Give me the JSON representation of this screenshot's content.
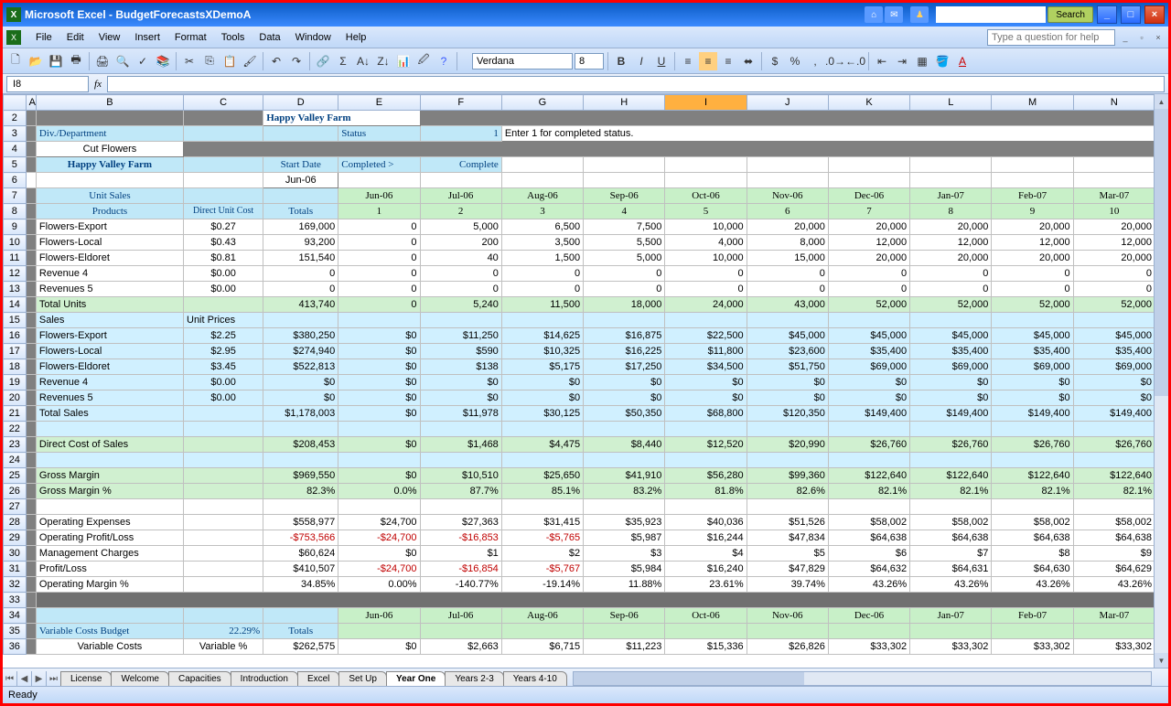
{
  "app": {
    "title": "Microsoft Excel - BudgetForecastsXDemoA",
    "search_btn": "Search"
  },
  "menu": [
    "File",
    "Edit",
    "View",
    "Insert",
    "Format",
    "Tools",
    "Data",
    "Window",
    "Help"
  ],
  "helpbox": "Type a question for help",
  "font": {
    "name": "Verdana",
    "size": "8"
  },
  "namebox": "I8",
  "cols": [
    "A",
    "B",
    "C",
    "D",
    "E",
    "F",
    "G",
    "H",
    "I",
    "J",
    "K",
    "L",
    "M",
    "N"
  ],
  "hdr": {
    "farm": "Happy Valley Farm",
    "div": "Div./Department",
    "status": "Status",
    "status_val": "1",
    "status_note": "Enter 1 for completed status.",
    "cut": "Cut Flowers",
    "start": "Start Date",
    "completed": "Completed >",
    "complete": "Complete",
    "jun06": "Jun-06",
    "unit_sales": "Unit Sales",
    "products": "Products",
    "duc": "Direct Unit Cost",
    "totals": "Totals",
    "months": [
      "Jun-06",
      "Jul-06",
      "Aug-06",
      "Sep-06",
      "Oct-06",
      "Nov-06",
      "Dec-06",
      "Jan-07",
      "Feb-07",
      "Mar-07"
    ],
    "monthnums": [
      "1",
      "2",
      "3",
      "4",
      "5",
      "6",
      "7",
      "8",
      "9",
      "10"
    ]
  },
  "rows_units": [
    {
      "n": "Flowers-Export",
      "c": "$0.27",
      "t": "169,000",
      "v": [
        "0",
        "5,000",
        "6,500",
        "7,500",
        "10,000",
        "20,000",
        "20,000",
        "20,000",
        "20,000",
        "20,000"
      ]
    },
    {
      "n": "Flowers-Local",
      "c": "$0.43",
      "t": "93,200",
      "v": [
        "0",
        "200",
        "3,500",
        "5,500",
        "4,000",
        "8,000",
        "12,000",
        "12,000",
        "12,000",
        "12,000"
      ]
    },
    {
      "n": "Flowers-Eldoret",
      "c": "$0.81",
      "t": "151,540",
      "v": [
        "0",
        "40",
        "1,500",
        "5,000",
        "10,000",
        "15,000",
        "20,000",
        "20,000",
        "20,000",
        "20,000"
      ]
    },
    {
      "n": "Revenue 4",
      "c": "$0.00",
      "t": "0",
      "v": [
        "0",
        "0",
        "0",
        "0",
        "0",
        "0",
        "0",
        "0",
        "0",
        "0"
      ]
    },
    {
      "n": "Revenues 5",
      "c": "$0.00",
      "t": "0",
      "v": [
        "0",
        "0",
        "0",
        "0",
        "0",
        "0",
        "0",
        "0",
        "0",
        "0"
      ]
    }
  ],
  "total_units": {
    "n": "Total Units",
    "t": "413,740",
    "v": [
      "0",
      "5,240",
      "11,500",
      "18,000",
      "24,000",
      "43,000",
      "52,000",
      "52,000",
      "52,000",
      "52,000"
    ]
  },
  "sales_hdr": {
    "n": "Sales",
    "c": "Unit Prices"
  },
  "rows_sales": [
    {
      "n": "Flowers-Export",
      "c": "$2.25",
      "t": "$380,250",
      "v": [
        "$0",
        "$11,250",
        "$14,625",
        "$16,875",
        "$22,500",
        "$45,000",
        "$45,000",
        "$45,000",
        "$45,000",
        "$45,000"
      ]
    },
    {
      "n": "Flowers-Local",
      "c": "$2.95",
      "t": "$274,940",
      "v": [
        "$0",
        "$590",
        "$10,325",
        "$16,225",
        "$11,800",
        "$23,600",
        "$35,400",
        "$35,400",
        "$35,400",
        "$35,400"
      ]
    },
    {
      "n": "Flowers-Eldoret",
      "c": "$3.45",
      "t": "$522,813",
      "v": [
        "$0",
        "$138",
        "$5,175",
        "$17,250",
        "$34,500",
        "$51,750",
        "$69,000",
        "$69,000",
        "$69,000",
        "$69,000"
      ]
    },
    {
      "n": "Revenue 4",
      "c": "$0.00",
      "t": "$0",
      "v": [
        "$0",
        "$0",
        "$0",
        "$0",
        "$0",
        "$0",
        "$0",
        "$0",
        "$0",
        "$0"
      ]
    },
    {
      "n": "Revenues 5",
      "c": "$0.00",
      "t": "$0",
      "v": [
        "$0",
        "$0",
        "$0",
        "$0",
        "$0",
        "$0",
        "$0",
        "$0",
        "$0",
        "$0"
      ]
    }
  ],
  "total_sales": {
    "n": "Total Sales",
    "t": "$1,178,003",
    "v": [
      "$0",
      "$11,978",
      "$30,125",
      "$50,350",
      "$68,800",
      "$120,350",
      "$149,400",
      "$149,400",
      "$149,400",
      "$149,400"
    ]
  },
  "dcos": {
    "n": "Direct Cost of Sales",
    "t": "$208,453",
    "v": [
      "$0",
      "$1,468",
      "$4,475",
      "$8,440",
      "$12,520",
      "$20,990",
      "$26,760",
      "$26,760",
      "$26,760",
      "$26,760"
    ]
  },
  "gm": {
    "n": "Gross Margin",
    "t": "$969,550",
    "v": [
      "$0",
      "$10,510",
      "$25,650",
      "$41,910",
      "$56,280",
      "$99,360",
      "$122,640",
      "$122,640",
      "$122,640",
      "$122,640"
    ]
  },
  "gmp": {
    "n": "Gross Margin %",
    "t": "82.3%",
    "v": [
      "0.0%",
      "87.7%",
      "85.1%",
      "83.2%",
      "81.8%",
      "82.6%",
      "82.1%",
      "82.1%",
      "82.1%",
      "82.1%"
    ]
  },
  "opex": {
    "n": "Operating Expenses",
    "t": "$558,977",
    "v": [
      "$24,700",
      "$27,363",
      "$31,415",
      "$35,923",
      "$40,036",
      "$51,526",
      "$58,002",
      "$58,002",
      "$58,002",
      "$58,002"
    ]
  },
  "opl": {
    "n": "Operating Profit/Loss",
    "t": "-$753,566",
    "v": [
      "-$24,700",
      "-$16,853",
      "-$5,765",
      "$5,987",
      "$16,244",
      "$47,834",
      "$64,638",
      "$64,638",
      "$64,638",
      "$64,638"
    ],
    "neg": [
      0,
      1,
      2,
      3
    ]
  },
  "mgmt": {
    "n": "Management Charges",
    "t": "$60,624",
    "v": [
      "$0",
      "$1",
      "$2",
      "$3",
      "$4",
      "$5",
      "$6",
      "$7",
      "$8",
      "$9"
    ]
  },
  "pl": {
    "n": "Profit/Loss",
    "t": "$410,507",
    "v": [
      "-$24,700",
      "-$16,854",
      "-$5,767",
      "$5,984",
      "$16,240",
      "$47,829",
      "$64,632",
      "$64,631",
      "$64,630",
      "$64,629"
    ],
    "neg": [
      1,
      2,
      3
    ]
  },
  "opm": {
    "n": "Operating Margin %",
    "t": "34.85%",
    "v": [
      "0.00%",
      "-140.77%",
      "-19.14%",
      "11.88%",
      "23.61%",
      "39.74%",
      "43.26%",
      "43.26%",
      "43.26%",
      "43.26%"
    ]
  },
  "vcb": {
    "n": "Variable Costs Budget",
    "c": "22.29%",
    "hdr": "Totals"
  },
  "vc": {
    "n": "Variable Costs",
    "c": "Variable %",
    "t": "$262,575",
    "v": [
      "$0",
      "$2,663",
      "$6,715",
      "$11,223",
      "$15,336",
      "$26,826",
      "$33,302",
      "$33,302",
      "$33,302",
      "$33,302"
    ]
  },
  "tabs": [
    "License",
    "Welcome",
    "Capacities",
    "Introduction",
    "Excel",
    "Set Up",
    "Year One",
    "Years 2-3",
    "Years 4-10"
  ],
  "active_tab": "Year One",
  "status": "Ready"
}
